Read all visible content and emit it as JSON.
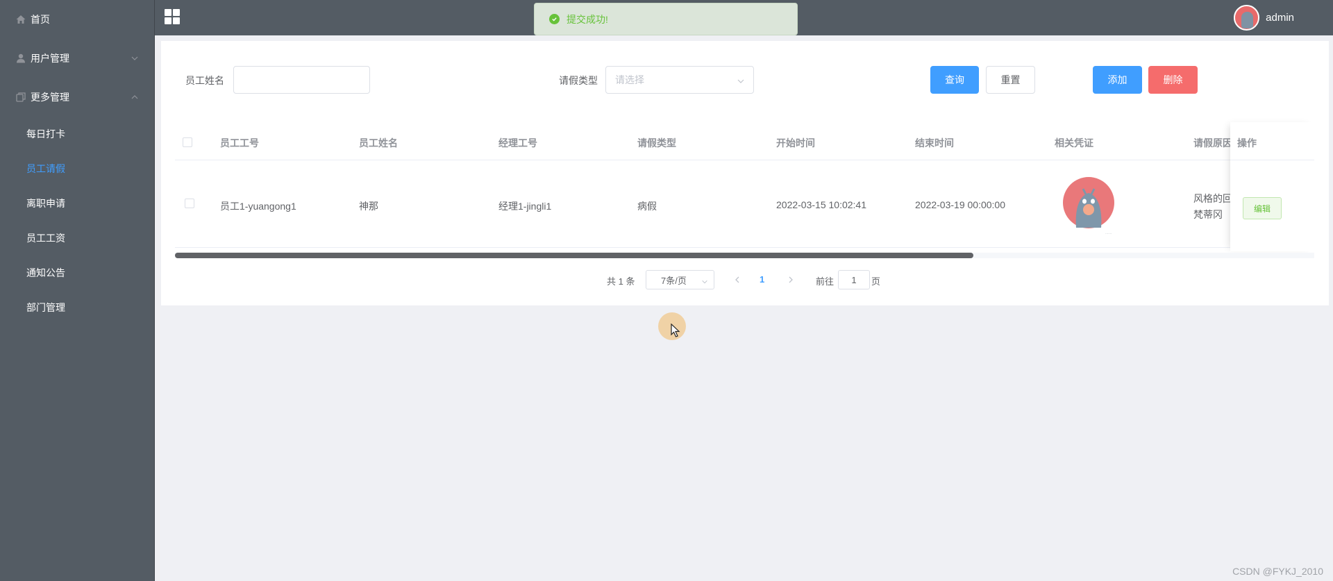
{
  "sidebar": {
    "items": [
      {
        "label": "首页",
        "icon": "home-icon"
      },
      {
        "label": "用户管理",
        "icon": "user-icon",
        "arrow": "chevron-down-icon"
      },
      {
        "label": "更多管理",
        "icon": "copy-icon",
        "arrow": "chevron-up-icon"
      }
    ],
    "sub_items": [
      {
        "label": "每日打卡",
        "active": false
      },
      {
        "label": "员工请假",
        "active": true
      },
      {
        "label": "离职申请",
        "active": false
      },
      {
        "label": "员工工资",
        "active": false
      },
      {
        "label": "通知公告",
        "active": false
      },
      {
        "label": "部门管理",
        "active": false
      }
    ]
  },
  "header": {
    "menu_icon": "grid-icon",
    "username": "admin"
  },
  "toast": {
    "message": "提交成功!",
    "icon": "success-icon"
  },
  "search": {
    "name_label": "员工姓名",
    "name_value": "",
    "type_label": "请假类型",
    "type_placeholder": "请选择",
    "query_label": "查询",
    "reset_label": "重置",
    "add_label": "添加",
    "delete_label": "删除"
  },
  "table": {
    "headers": [
      "员工工号",
      "员工姓名",
      "经理工号",
      "请假类型",
      "开始时间",
      "结束时间",
      "相关凭证",
      "请假原因",
      "操作"
    ],
    "rows": [
      {
        "employee_id": "员工1-yuangong1",
        "employee_name": "神那",
        "manager_id": "经理1-jingli1",
        "leave_type": "病假",
        "start_time": "2022-03-15 10:02:41",
        "end_time": "2022-03-19 00:00:00",
        "reason_line1": "风格的回",
        "reason_line2": "梵蒂冈",
        "edit_label": "编辑"
      }
    ]
  },
  "pagination": {
    "total": "共 1 条",
    "page_size": "7条/页",
    "current_page": "1",
    "goto_prefix": "前往",
    "goto_value": "1",
    "goto_suffix": "页"
  },
  "colors": {
    "sidebar_bg": "#545c64",
    "accent": "#409eff",
    "danger": "#f56c6c",
    "success": "#67c23a"
  },
  "watermark": "CSDN @FYKJ_2010"
}
